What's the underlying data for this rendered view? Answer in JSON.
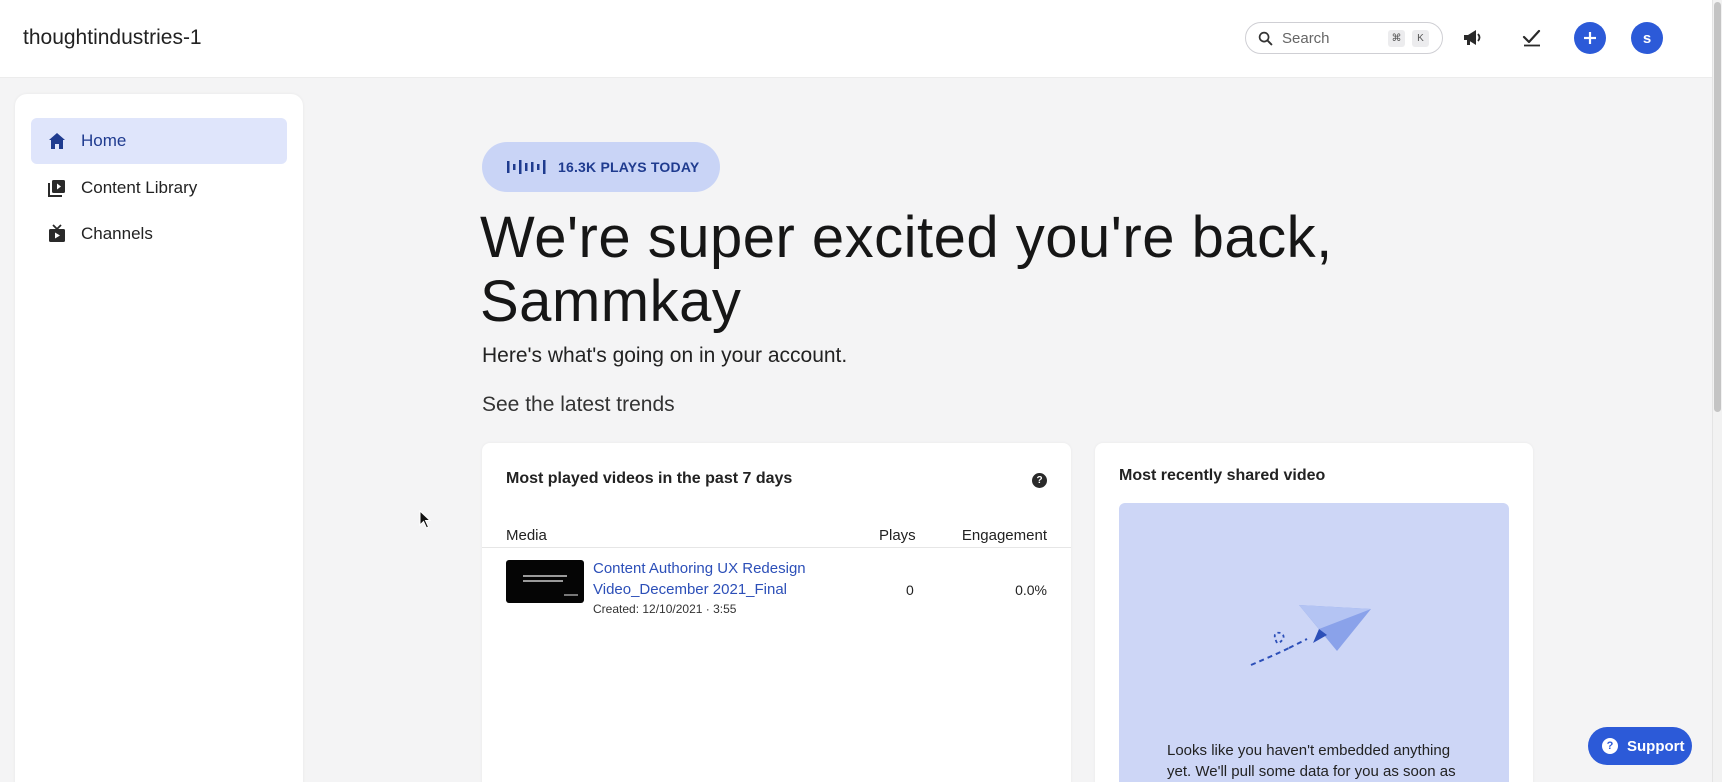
{
  "header": {
    "account_name": "thoughtindustries-1",
    "search_placeholder": "Search",
    "shortcut_keys": [
      "⌘",
      "K"
    ],
    "icons": [
      "megaphone-icon",
      "checkmark-icon",
      "plus-icon"
    ],
    "avatar_initial": "s"
  },
  "sidebar": {
    "items": [
      {
        "label": "Home",
        "icon": "home-icon",
        "active": true
      },
      {
        "label": "Content Library",
        "icon": "library-icon",
        "active": false
      },
      {
        "label": "Channels",
        "icon": "tv-icon",
        "active": false
      }
    ]
  },
  "main": {
    "plays_today": "16.3K PLAYS TODAY",
    "hero_line1": "We're super excited you're back,",
    "hero_line2": "Sammkay",
    "subtitle": "Here's what's going on in your account.",
    "section_title": "See the latest trends",
    "most_played": {
      "title": "Most played videos in the past 7 days",
      "help": "?",
      "columns": [
        "Media",
        "Plays",
        "Engagement"
      ],
      "rows": [
        {
          "title": "Content Authoring UX Redesign Video_December 2021_Final",
          "meta": "Created: 12/10/2021 · 3:55",
          "plays": "0",
          "engagement": "0.0%"
        }
      ]
    },
    "recent_share": {
      "title": "Most recently shared video",
      "message": "Looks like you haven't embedded anything yet. We'll pull some data for you as soon as"
    }
  },
  "support": {
    "label": "Support",
    "icon": "?"
  },
  "colors": {
    "accent": "#2c5ad8",
    "link": "#2c4fb8",
    "active_nav": "#dfe5fb",
    "pill_bg": "#c9d4f6",
    "share_bg": "#cdd6f6"
  }
}
